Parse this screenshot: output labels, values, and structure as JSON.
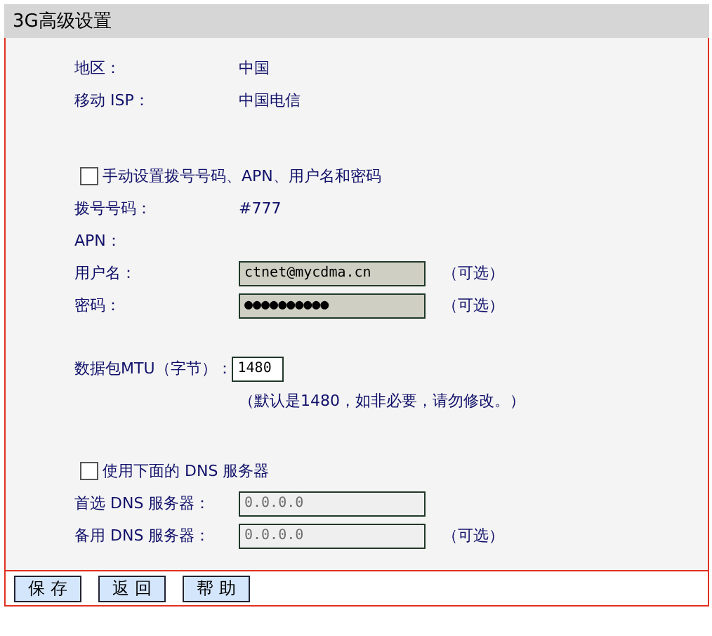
{
  "title": "3G高级设置",
  "info_rows": [
    {
      "label": "地区：",
      "value": "中国"
    },
    {
      "label": "移动 ISP：",
      "value": "中国电信"
    }
  ],
  "manual_option": {
    "label": "手动设置拨号号码、APN、用户名和密码",
    "checked": false
  },
  "dial_rows": [
    {
      "kind": "text",
      "label": "拨号号码：",
      "value": "#777"
    },
    {
      "kind": "text",
      "label": "APN："
    },
    {
      "kind": "field",
      "label": "用户名：",
      "value": "ctnet@mycdma.cn",
      "disabled": true,
      "note": "（可选）"
    },
    {
      "kind": "field",
      "label": "密码：",
      "value": "●●●●●●●●●●",
      "disabled": true,
      "note": "（可选）"
    }
  ],
  "mtu": {
    "label": "数据包MTU（字节）：",
    "value": "1480",
    "disabled": false,
    "hint": "（默认是1480，如非必要，请勿修改。）"
  },
  "dns_option": {
    "label": "使用下面的 DNS 服务器",
    "checked": false
  },
  "dns_rows": [
    {
      "kind": "field",
      "label": "首选 DNS 服务器：",
      "value": "0.0.0.0",
      "disabled": true
    },
    {
      "kind": "field",
      "label": "备用 DNS 服务器：",
      "value": "0.0.0.0",
      "disabled": true,
      "note": "（可选）"
    }
  ],
  "buttons": [
    "保 存",
    "返 回",
    "帮 助"
  ]
}
